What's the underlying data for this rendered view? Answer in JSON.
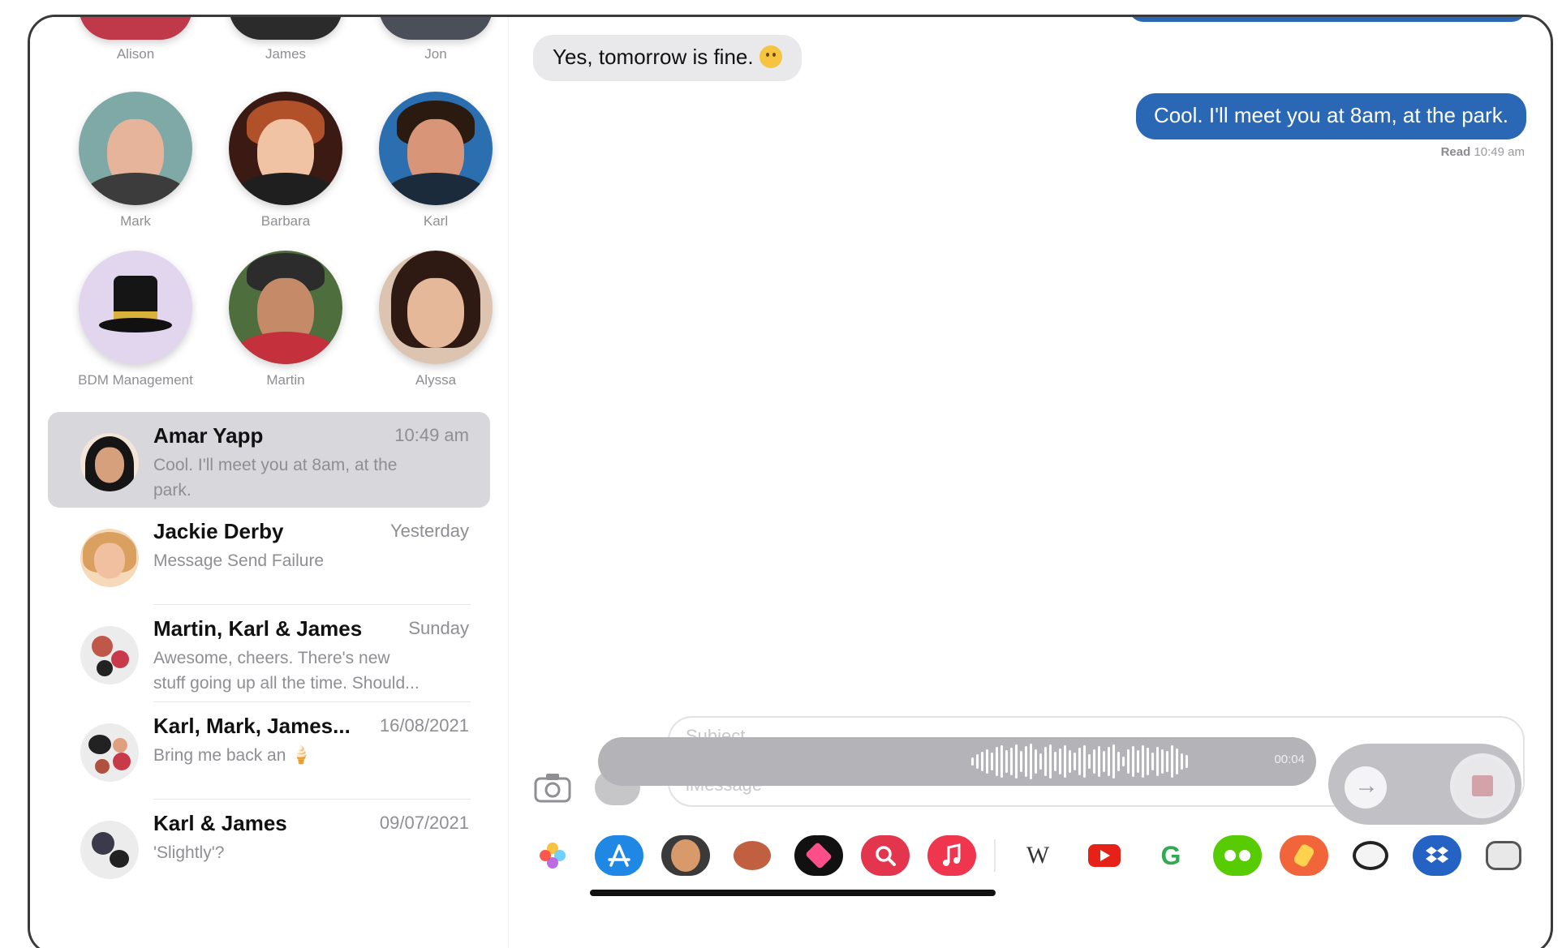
{
  "pinned_contacts": [
    {
      "name": "Alison"
    },
    {
      "name": "James"
    },
    {
      "name": "Jon"
    },
    {
      "name": "Mark"
    },
    {
      "name": "Barbara"
    },
    {
      "name": "Karl"
    },
    {
      "name": "BDM Management"
    },
    {
      "name": "Martin"
    },
    {
      "name": "Alyssa"
    }
  ],
  "conversations": [
    {
      "name": "Amar Yapp",
      "time": "10:49 am",
      "preview": "Cool. I'll meet you at 8am, at the park."
    },
    {
      "name": "Jackie Derby",
      "time": "Yesterday",
      "preview": "Message Send Failure"
    },
    {
      "name": "Martin, Karl & James",
      "time": "Sunday",
      "preview": "Awesome, cheers. There's new stuff going up all the time. Should..."
    },
    {
      "name": "Karl, Mark, James...",
      "time": "16/08/2021",
      "preview": "Bring me back an 🍦"
    },
    {
      "name": "Karl & James",
      "time": "09/07/2021",
      "preview": "'Slightly'?"
    }
  ],
  "chat": {
    "incoming_message": "Yes, tomorrow is fine.",
    "outgoing_message": "Cool. I'll meet you at 8am, at the park.",
    "read_label": "Read",
    "read_time": "10:49 am"
  },
  "composer": {
    "subject_placeholder": "Subject",
    "message_placeholder": "iMessage",
    "audio_duration": "00:04"
  },
  "app_drawer": [
    {
      "icon": "photos-icon"
    },
    {
      "icon": "app-store-icon"
    },
    {
      "icon": "memoji-icon"
    },
    {
      "icon": "animoji-icon"
    },
    {
      "icon": "digital-touch-icon"
    },
    {
      "icon": "images-search-icon"
    },
    {
      "icon": "music-icon"
    },
    {
      "icon": "wikipedia-icon",
      "label": "W"
    },
    {
      "icon": "youtube-icon"
    },
    {
      "icon": "google-icon",
      "label": "G"
    },
    {
      "icon": "duolingo-icon"
    },
    {
      "icon": "music-game-icon"
    },
    {
      "icon": "panda-sticker-icon"
    },
    {
      "icon": "dropbox-icon"
    },
    {
      "icon": "sticker-pack-icon"
    }
  ],
  "colors": {
    "outgoing_bubble": "#2a68b5",
    "incoming_bubble": "#e9e9eb",
    "selected_row": "#d7d7dc"
  }
}
